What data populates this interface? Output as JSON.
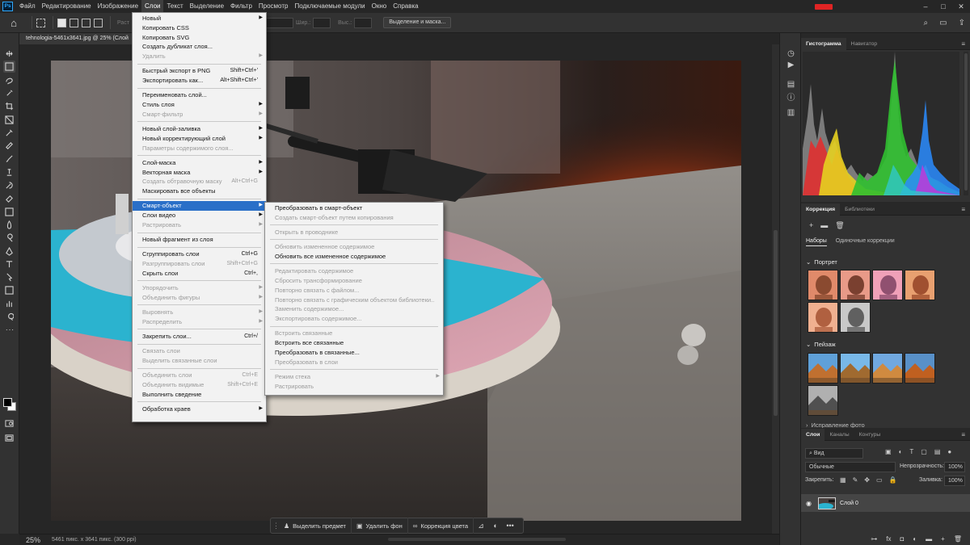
{
  "app": {
    "logo": "Ps"
  },
  "menubar": {
    "items": [
      "Файл",
      "Редактирование",
      "Изображение",
      "Слои",
      "Текст",
      "Выделение",
      "Фильтр",
      "Просмотр",
      "Подключаемые модули",
      "Окно",
      "Справка"
    ],
    "active_index": 3
  },
  "window_controls": {
    "minimize": "–",
    "maximize": "□",
    "close": "✕"
  },
  "options": {
    "mode_prefix": "Раст",
    "style_value": "ный",
    "width_label": "Шир.:",
    "height_label": "Выс.:",
    "select_mask_button": "Выделение и маска..."
  },
  "document": {
    "tab_title": "tehnologia-5461x3641.jpg @ 25% (Слой",
    "zoom": "25%",
    "status": "5461 пикс. x 3641 пикс. (300 ppi)"
  },
  "menu_main": [
    {
      "label": "Новый",
      "arrow": true
    },
    {
      "label": "Копировать CSS"
    },
    {
      "label": "Копировать SVG"
    },
    {
      "label": "Создать дубликат слоя..."
    },
    {
      "label": "Удалить",
      "disabled": true,
      "arrow": true
    },
    {
      "sep": true
    },
    {
      "label": "Быстрый экспорт в PNG",
      "shortcut": "Shift+Ctrl+'"
    },
    {
      "label": "Экспортировать как...",
      "shortcut": "Alt+Shift+Ctrl+'"
    },
    {
      "sep": true
    },
    {
      "label": "Переименовать слой..."
    },
    {
      "label": "Стиль слоя",
      "arrow": true
    },
    {
      "label": "Смарт-фильтр",
      "disabled": true,
      "arrow": true
    },
    {
      "sep": true
    },
    {
      "label": "Новый слой-заливка",
      "arrow": true
    },
    {
      "label": "Новый корректирующий слой",
      "arrow": true
    },
    {
      "label": "Параметры содержимого слоя...",
      "disabled": true
    },
    {
      "sep": true
    },
    {
      "label": "Слой-маска",
      "arrow": true
    },
    {
      "label": "Векторная маска",
      "arrow": true
    },
    {
      "label": "Создать обтравочную маску",
      "shortcut": "Alt+Ctrl+G",
      "disabled": true
    },
    {
      "label": "Маскировать все объекты"
    },
    {
      "sep": true
    },
    {
      "label": "Смарт-объект",
      "arrow": true,
      "highlight": true
    },
    {
      "label": "Слои видео",
      "arrow": true
    },
    {
      "label": "Растрировать",
      "disabled": true,
      "arrow": true
    },
    {
      "sep": true
    },
    {
      "label": "Новый фрагмент из слоя"
    },
    {
      "sep": true
    },
    {
      "label": "Сгруппировать слои",
      "shortcut": "Ctrl+G"
    },
    {
      "label": "Разгруппировать слои",
      "shortcut": "Shift+Ctrl+G",
      "disabled": true
    },
    {
      "label": "Скрыть слои",
      "shortcut": "Ctrl+,"
    },
    {
      "sep": true
    },
    {
      "label": "Упорядочить",
      "disabled": true,
      "arrow": true
    },
    {
      "label": "Объединить фигуры",
      "disabled": true,
      "arrow": true
    },
    {
      "sep": true
    },
    {
      "label": "Выровнять",
      "disabled": true,
      "arrow": true
    },
    {
      "label": "Распределить",
      "disabled": true,
      "arrow": true
    },
    {
      "sep": true
    },
    {
      "label": "Закрепить слои...",
      "shortcut": "Ctrl+/"
    },
    {
      "sep": true
    },
    {
      "label": "Связать слои",
      "disabled": true
    },
    {
      "label": "Выделить связанные слои",
      "disabled": true
    },
    {
      "sep": true
    },
    {
      "label": "Объединить слои",
      "shortcut": "Ctrl+E",
      "disabled": true
    },
    {
      "label": "Объединить видимые",
      "shortcut": "Shift+Ctrl+E",
      "disabled": true
    },
    {
      "label": "Выполнить сведение"
    },
    {
      "sep": true
    },
    {
      "label": "Обработка краев",
      "arrow": true
    }
  ],
  "menu_sub": [
    {
      "label": "Преобразовать в смарт-объект"
    },
    {
      "label": "Создать смарт-объект путем копирования",
      "disabled": true
    },
    {
      "sep": true
    },
    {
      "label": "Открыть в проводнике",
      "disabled": true
    },
    {
      "sep": true
    },
    {
      "label": "Обновить измененное содержимое",
      "disabled": true
    },
    {
      "label": "Обновить все измененное содержимое"
    },
    {
      "sep": true
    },
    {
      "label": "Редактировать содержимое",
      "disabled": true
    },
    {
      "label": "Сбросить трансформирование",
      "disabled": true
    },
    {
      "label": "Повторно связать с файлом...",
      "disabled": true
    },
    {
      "label": "Повторно связать с графическим объектом библиотеки...",
      "disabled": true
    },
    {
      "label": "Заменить содержимое...",
      "disabled": true
    },
    {
      "label": "Экспортировать содержимое...",
      "disabled": true
    },
    {
      "sep": true
    },
    {
      "label": "Встроить связанные",
      "disabled": true
    },
    {
      "label": "Встроить все связанные"
    },
    {
      "label": "Преобразовать в связанные..."
    },
    {
      "label": "Преобразовать в слои",
      "disabled": true
    },
    {
      "sep": true
    },
    {
      "label": "Режим стека",
      "disabled": true,
      "arrow": true
    },
    {
      "label": "Растрировать",
      "disabled": true
    }
  ],
  "taskbar": {
    "select_subject": "Выделить предмет",
    "remove_bg": "Удалить фон",
    "color_correction": "Коррекция цвета",
    "more": "•••"
  },
  "histogram_panel": {
    "tabs": [
      "Гистограмма",
      "Навигатор"
    ]
  },
  "adjustments_panel": {
    "tabs": [
      "Коррекция",
      "Библиотеки"
    ],
    "subtabs": [
      "Наборы",
      "Одиночные коррекции"
    ],
    "group_portrait": "Портрет",
    "group_landscape": "Пейзаж",
    "group_truncated": "Исправление фото"
  },
  "layers_panel": {
    "tabs": [
      "Слои",
      "Каналы",
      "Контуры"
    ],
    "filter": "Вид",
    "blend_mode": "Обычные",
    "opacity_label": "Непрозрачность:",
    "opacity_value": "100%",
    "lock_label": "Закрепить:",
    "fill_label": "Заливка:",
    "fill_value": "100%",
    "layer_name": "Слой 0"
  },
  "colors": {
    "highlight": "#2a6fc8",
    "menu_bg": "#f2f2f2",
    "panel_bg": "#323232"
  }
}
